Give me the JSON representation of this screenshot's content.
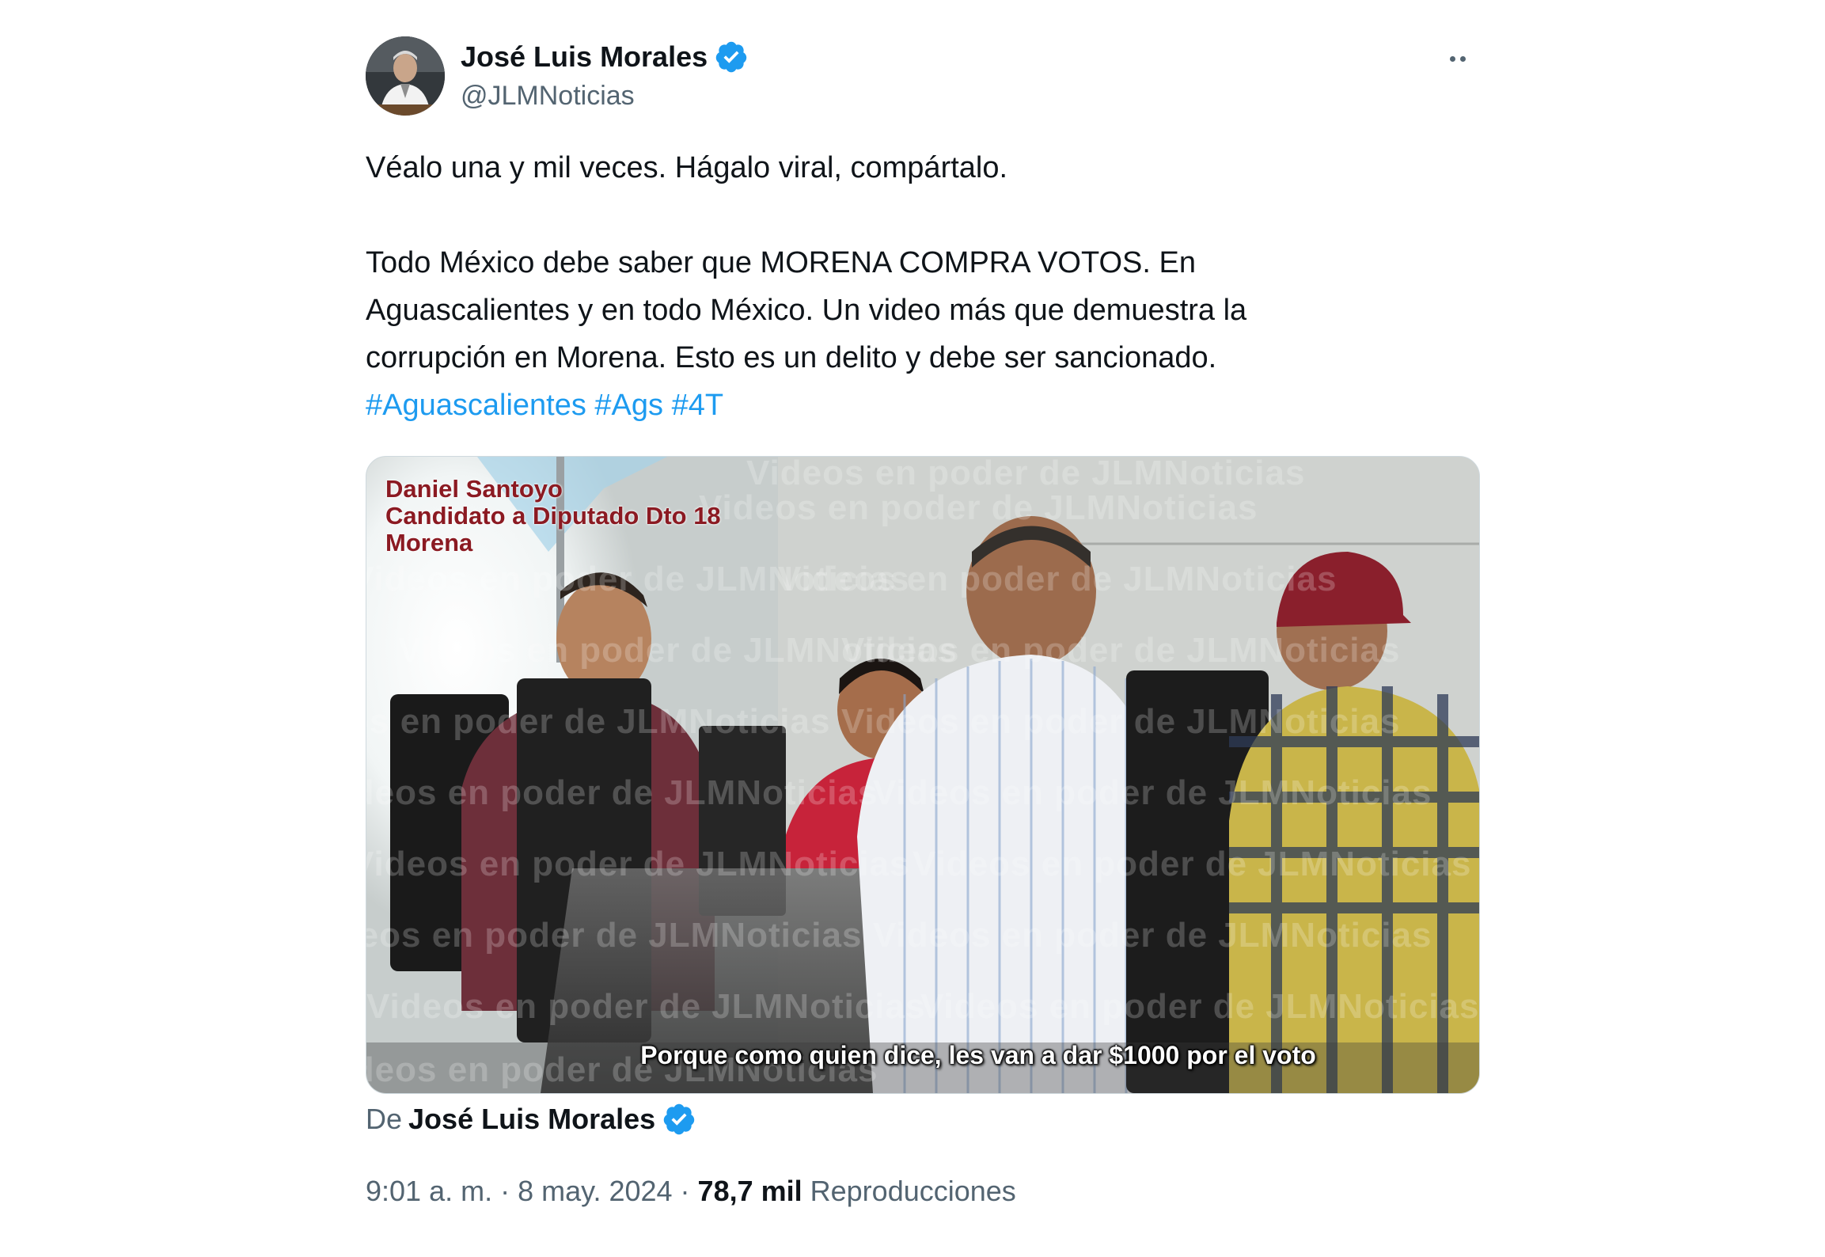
{
  "author": {
    "name": "José Luis Morales",
    "handle": "@JLMNoticias",
    "verified_icon": "verified-badge-icon",
    "verified_color": "#1d9bf0"
  },
  "tweet": {
    "paragraph1": "Véalo una y mil veces. Hágalo viral, compártalo.",
    "paragraph2_line1": "Todo México debe saber que MORENA COMPRA VOTOS. En",
    "paragraph2_line2": "Aguascalientes y en todo México. Un video más que demuestra la",
    "paragraph2_line3": "corrupción en Morena. Esto es un delito y debe ser sancionado.",
    "hashtags": [
      "#Aguascalientes",
      "#Ags",
      "#4T"
    ],
    "hashtag_color": "#1d9bf0"
  },
  "media": {
    "overlay_line1": "Daniel Santoyo",
    "overlay_line2": "Candidato a Diputado Dto 18",
    "overlay_line3": "Morena",
    "subtitle": "Porque como quien dice, les van a dar $1000 por el voto",
    "watermark": "Videos en poder de JLMNoticias"
  },
  "from": {
    "prefix": "De",
    "name": "José Luis Morales"
  },
  "meta": {
    "time": "9:01 a. m.",
    "separator": "·",
    "date": "8 may. 2024",
    "views_count": "78,7 mil",
    "views_label": "Reproducciones"
  }
}
